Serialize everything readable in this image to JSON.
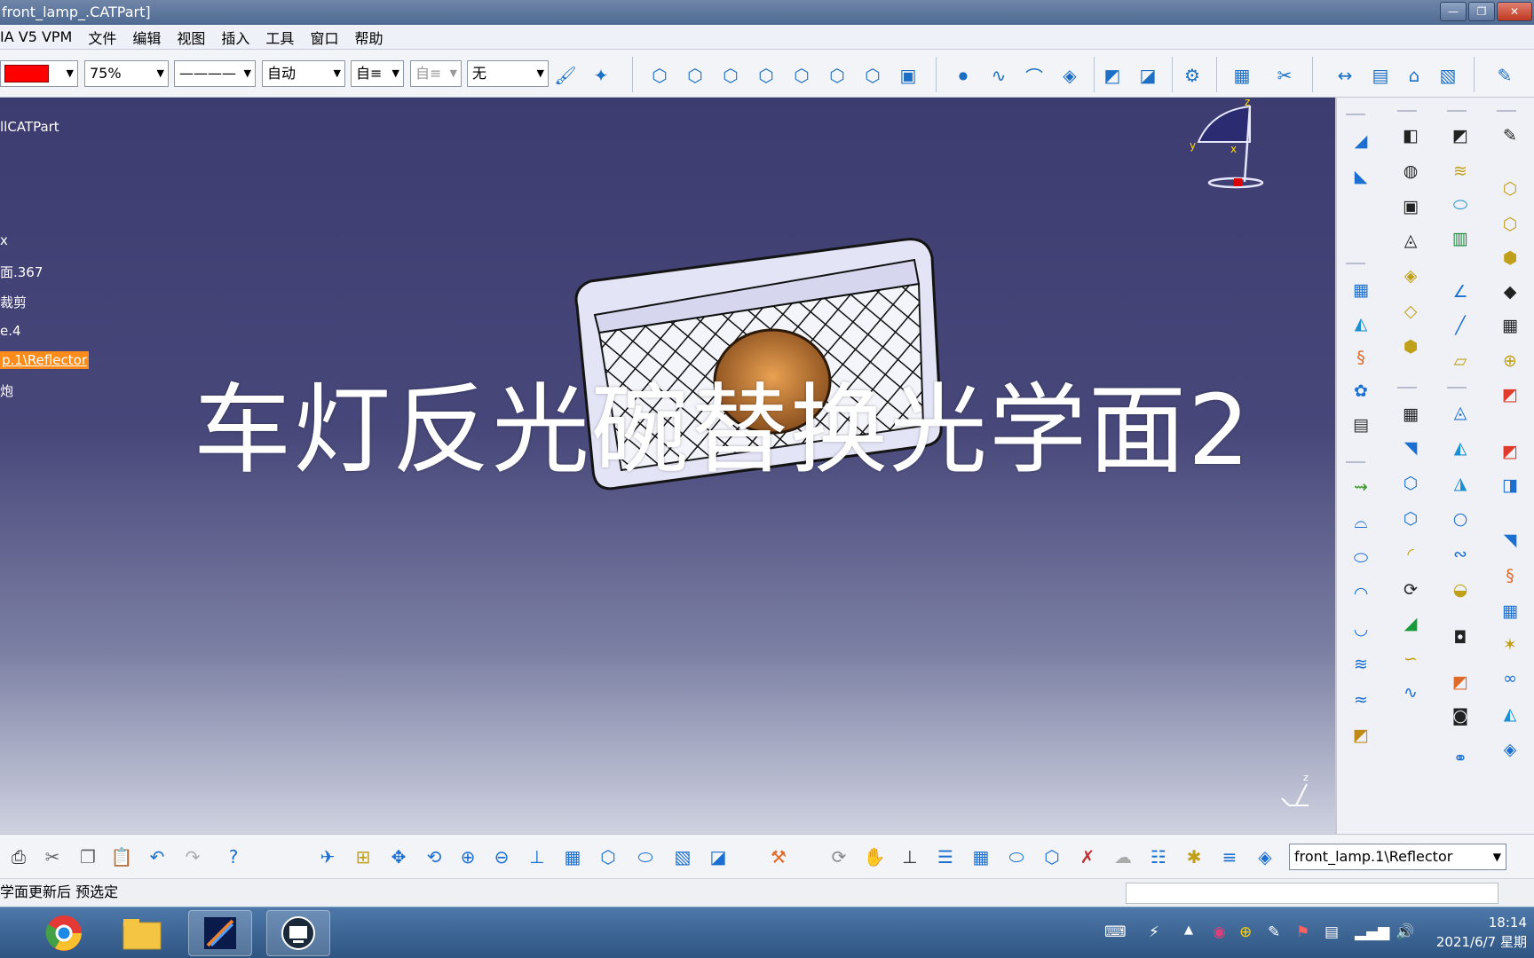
{
  "window": {
    "title": "front_lamp_.CATPart]",
    "buttons": [
      "—",
      "❐",
      "✕"
    ]
  },
  "menu": {
    "items": [
      "IA V5 VPM",
      "文件",
      "编辑",
      "视图",
      "插入",
      "工具",
      "窗口",
      "帮助"
    ]
  },
  "toolbar_top": {
    "color": "#ff0000",
    "transparency": "75%",
    "line_weight": "————",
    "line_type": "自动",
    "point_type": "自≡",
    "layer_disabled": "自≡",
    "layer": "无"
  },
  "tree": {
    "items": [
      "llCATPart",
      "x",
      "面.367",
      "裁剪",
      "e.4",
      "p.1\\Reflector",
      "炮"
    ]
  },
  "overlay_caption": "车灯反光碗替换光学面2",
  "compass": {
    "x": "x",
    "y": "y",
    "z": "z"
  },
  "bottom_toolbar": {
    "current_object": "front_lamp.1\\Reflector"
  },
  "status": {
    "message": "学面更新后 预选定"
  },
  "taskbar": {
    "time": "18:14",
    "date": "2021/6/7 星期"
  },
  "colors": {
    "viewport_top": "#3d3c70",
    "viewport_bottom": "#cfd2e0",
    "tree_highlight": "#ff8c1a",
    "accent": "#1d6fc4"
  }
}
